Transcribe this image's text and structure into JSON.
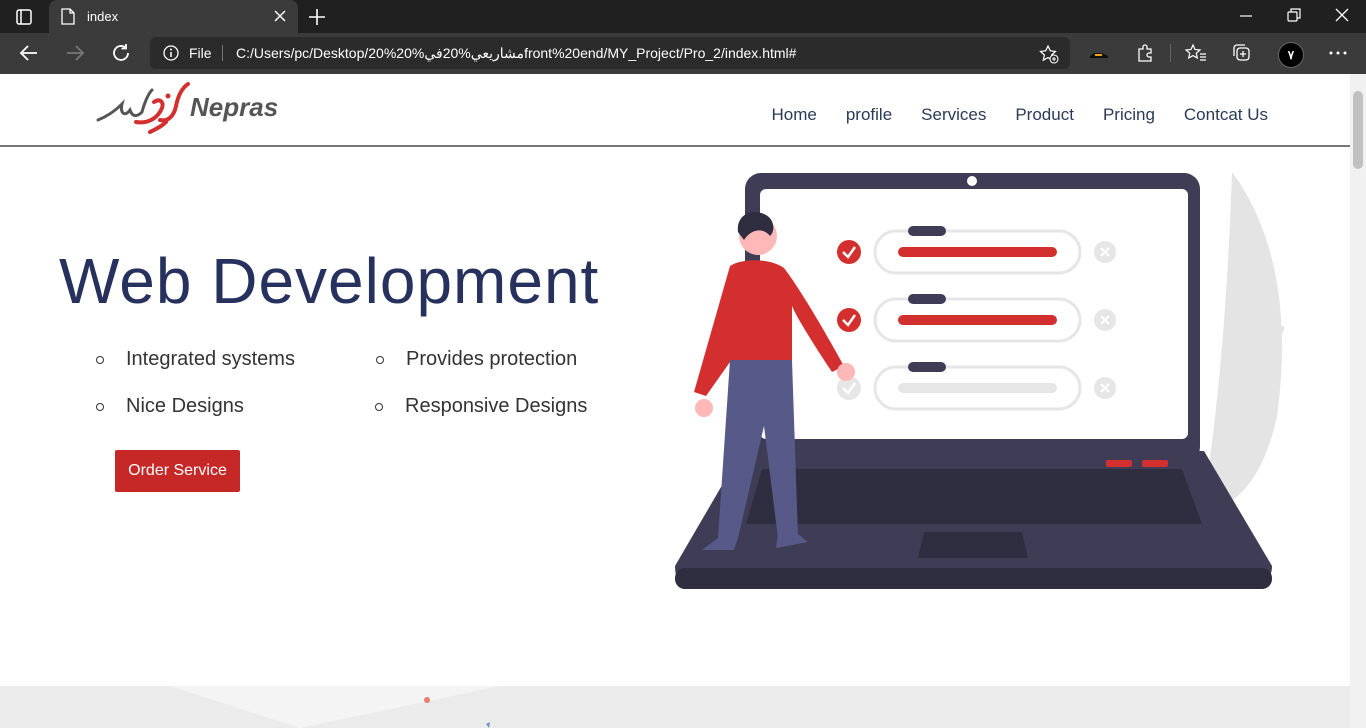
{
  "browser": {
    "tab_title": "index",
    "file_label": "File",
    "url": "C:/Users/pc/Desktop/20%مشاريعي%20في%20front%20end/MY_Project/Pro_2/index.html#",
    "profile_initial": "٧"
  },
  "header": {
    "logo_text": "Nepras",
    "nav": [
      "Home",
      "profile",
      "Services",
      "Product",
      "Pricing",
      "Contcat Us"
    ]
  },
  "hero": {
    "title": "Web Development",
    "features": [
      "Integrated systems",
      "Provides protection",
      "Nice Designs",
      "Responsive Designs"
    ],
    "order_button": "Order Service"
  },
  "colors": {
    "accent": "#c62828",
    "title": "#26315e",
    "laptop": "#3f3d56",
    "figure_pants": "#575a89"
  }
}
